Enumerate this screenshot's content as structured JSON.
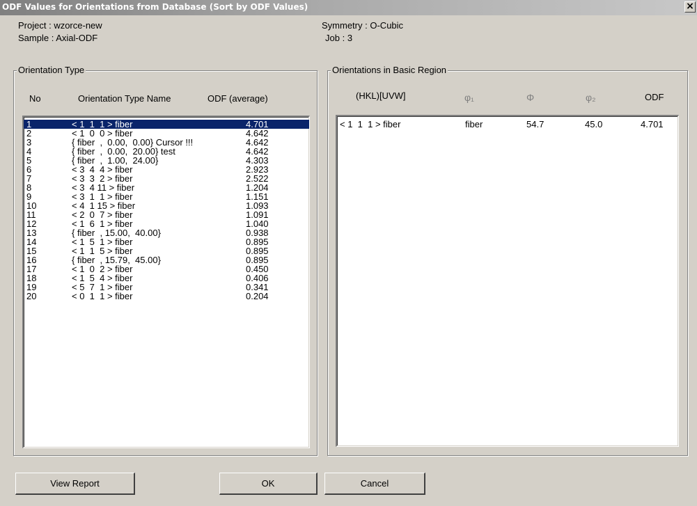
{
  "window": {
    "title": "ODF Values for Orientations from Database (Sort by ODF Values)",
    "close_glyph": "×"
  },
  "info": {
    "project_label": "Project :",
    "project_value": "wzorce-new",
    "sample_label": "Sample :",
    "sample_value": "Axial-ODF",
    "symmetry_label": "Symmetry :",
    "symmetry_value": "O-Cubic",
    "job_label": "Job :",
    "job_value": "3"
  },
  "left_group": {
    "title": "Orientation Type",
    "headers": {
      "no": "No",
      "name": "Orientation Type Name",
      "odf": "ODF (average)"
    },
    "selected_index": 0,
    "rows": [
      {
        "no": "1",
        "name": "< 1  1  1 > fiber",
        "odf": "4.701"
      },
      {
        "no": "2",
        "name": "< 1  0  0 > fiber",
        "odf": "4.642"
      },
      {
        "no": "3",
        "name": "{ fiber  ,  0.00,  0.00} Cursor !!!",
        "odf": "4.642"
      },
      {
        "no": "4",
        "name": "{ fiber  ,  0.00,  20.00} test",
        "odf": "4.642"
      },
      {
        "no": "5",
        "name": "{ fiber  ,  1.00,  24.00}",
        "odf": "4.303"
      },
      {
        "no": "6",
        "name": "< 3  4  4 > fiber",
        "odf": "2.923"
      },
      {
        "no": "7",
        "name": "< 3  3  2 > fiber",
        "odf": "2.522"
      },
      {
        "no": "8",
        "name": "< 3  4 11 > fiber",
        "odf": "1.204"
      },
      {
        "no": "9",
        "name": "< 3  1  1 > fiber",
        "odf": "1.151"
      },
      {
        "no": "10",
        "name": "< 4  1 15 > fiber",
        "odf": "1.093"
      },
      {
        "no": "11",
        "name": "< 2  0  7 > fiber",
        "odf": "1.091"
      },
      {
        "no": "12",
        "name": "< 1  6  1 > fiber",
        "odf": "1.040"
      },
      {
        "no": "13",
        "name": "{ fiber  , 15.00,  40.00}",
        "odf": "0.938"
      },
      {
        "no": "14",
        "name": "< 1  5  1 > fiber",
        "odf": "0.895"
      },
      {
        "no": "15",
        "name": "< 1  1  5 > fiber",
        "odf": "0.895"
      },
      {
        "no": "16",
        "name": "{ fiber  , 15.79,  45.00}",
        "odf": "0.895"
      },
      {
        "no": "17",
        "name": "< 1  0  2 > fiber",
        "odf": "0.450"
      },
      {
        "no": "18",
        "name": "< 1  5  4 > fiber",
        "odf": "0.406"
      },
      {
        "no": "19",
        "name": "< 5  7  1 > fiber",
        "odf": "0.341"
      },
      {
        "no": "20",
        "name": "< 0  1  1 > fiber",
        "odf": "0.204"
      }
    ]
  },
  "right_group": {
    "title": "Orientations in Basic Region",
    "headers": {
      "hkl": "(HKL)[UVW]",
      "phi1": "φ₁",
      "Phi": "Φ",
      "phi2": "φ₂",
      "odf": "ODF"
    },
    "rows": [
      {
        "hkl": "< 1  1  1 > fiber",
        "phi1": "fiber",
        "Phi": "54.7",
        "phi2": "45.0",
        "odf": "4.701"
      }
    ]
  },
  "buttons": {
    "view_report": "View Report",
    "ok": "OK",
    "cancel": "Cancel"
  }
}
